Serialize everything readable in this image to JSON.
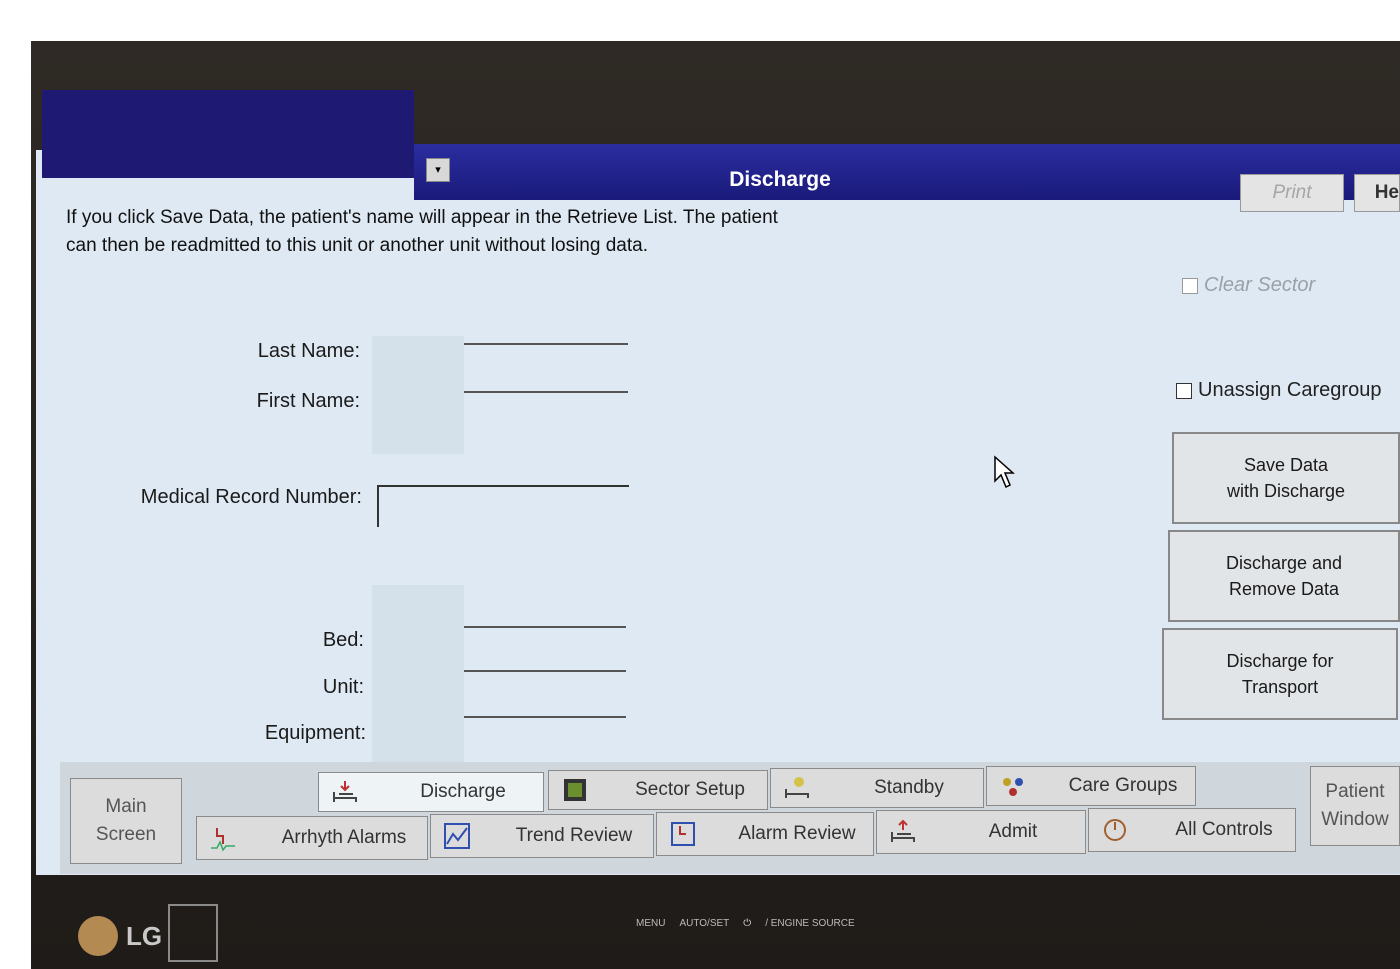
{
  "window": {
    "title": "Discharge",
    "buttons": {
      "print": "Print",
      "help": "He"
    }
  },
  "info_text": "If you click Save Data, the patient's name will appear in the Retrieve List. The patient can then be readmitted to this unit or another unit without losing data.",
  "form": {
    "last_name_label": "Last Name:",
    "first_name_label": "First Name:",
    "mrn_label": "Medical Record Number:",
    "bed_label": "Bed:",
    "unit_label": "Unit:",
    "equipment_label": "Equipment:"
  },
  "options": {
    "clear_sector": "Clear Sector",
    "unassign_caregroup": "Unassign Caregroup"
  },
  "actions": {
    "save_data": "Save Data\nwith Discharge",
    "discharge_remove": "Discharge and\nRemove Data",
    "discharge_transport": "Discharge for\nTransport"
  },
  "tabs": {
    "main_screen": "Main\nScreen",
    "patient_window": "Patient\nWindow",
    "row1": [
      "Discharge",
      "Sector Setup",
      "Standby",
      "Care Groups"
    ],
    "row2": [
      "Arrhyth Alarms",
      "Trend Review",
      "Alarm Review",
      "Admit",
      "All Controls"
    ]
  },
  "bezel": {
    "brand": "LG",
    "controls": [
      "MENU",
      "AUTO/SET",
      "/ ENGINE SOURCE"
    ]
  }
}
